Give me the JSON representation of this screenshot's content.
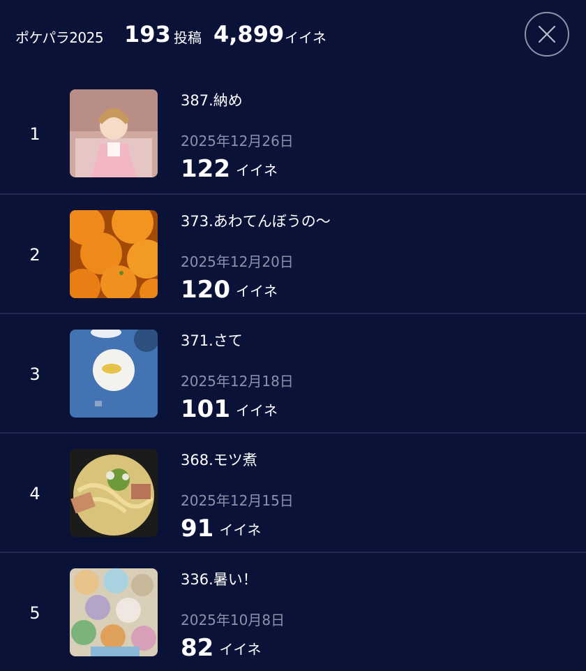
{
  "header": {
    "title": "ポケパラ2025",
    "posts_count": "193",
    "posts_label": "投稿",
    "likes_count": "4,899",
    "likes_label": "イイネ",
    "close_icon": "close-icon"
  },
  "ranking": [
    {
      "rank": "1",
      "title": "387.納め",
      "date": "2025年12月26日",
      "likes": "122",
      "likes_label": "イイネ"
    },
    {
      "rank": "2",
      "title": "373.あわてんぼうの〜",
      "date": "2025年12月20日",
      "likes": "120",
      "likes_label": "イイネ"
    },
    {
      "rank": "3",
      "title": "371.さて",
      "date": "2025年12月18日",
      "likes": "101",
      "likes_label": "イイネ"
    },
    {
      "rank": "4",
      "title": "368.モツ煮",
      "date": "2025年12月15日",
      "likes": "91",
      "likes_label": "イイネ"
    },
    {
      "rank": "5",
      "title": "336.暑い！",
      "date": "2025年10月8日",
      "likes": "82",
      "likes_label": "イイネ"
    }
  ],
  "colors": {
    "background": "#0b1238",
    "divider": "#222a52",
    "date_text": "#8c92aa"
  }
}
